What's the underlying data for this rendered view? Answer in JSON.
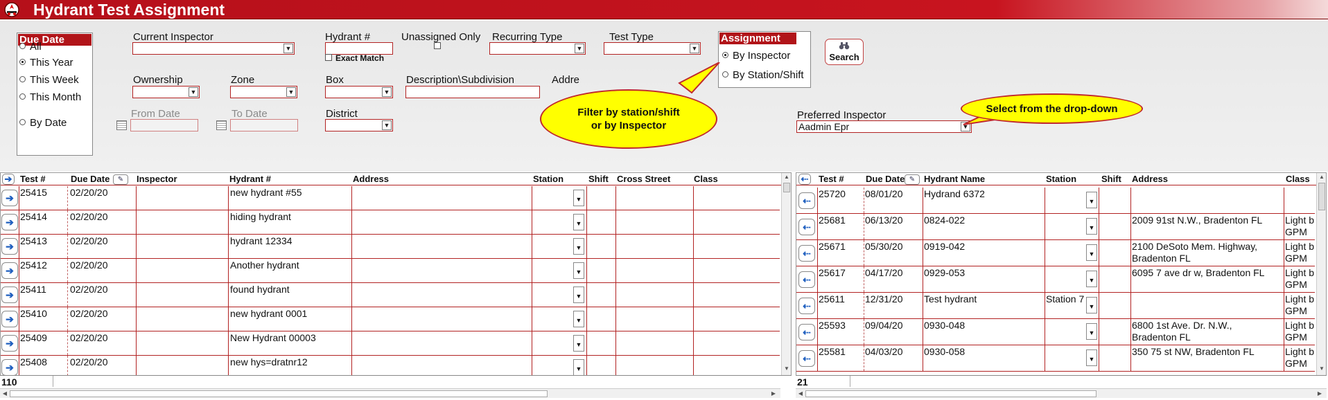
{
  "title": "Hydrant Test Assignment",
  "icons": {
    "logo": "fire-dept-logo-icon",
    "search": "binoculars-icon",
    "move_right": "arrow-right-icon",
    "move_left": "arrow-left-icon",
    "edit": "pencil-icon",
    "dropdown": "chevron-down-icon",
    "calendar": "calendar-icon"
  },
  "colors": {
    "accent": "#b11419",
    "callout": "#ffff00",
    "nav_arrow": "#1f5fbf"
  },
  "due_date": {
    "header": "Due Date",
    "options": [
      "All",
      "This Year",
      "This Week",
      "This Month",
      "By Date"
    ],
    "selected": "This Year"
  },
  "filters": {
    "current_inspector": {
      "label": "Current Inspector",
      "value": ""
    },
    "hydrant_number": {
      "label": "Hydrant #",
      "value": ""
    },
    "exact_match": {
      "label": "Exact Match",
      "checked": false
    },
    "unassigned_only": {
      "label": "Unassigned Only",
      "checked": false
    },
    "recurring_type": {
      "label": "Recurring Type",
      "value": ""
    },
    "test_type": {
      "label": "Test Type",
      "value": ""
    },
    "ownership": {
      "label": "Ownership",
      "value": ""
    },
    "zone": {
      "label": "Zone",
      "value": ""
    },
    "box": {
      "label": "Box",
      "value": ""
    },
    "description": {
      "label": "Description\\Subdivision",
      "value": ""
    },
    "address": {
      "label": "Addre"
    },
    "from_date": {
      "label": "From Date",
      "value": ""
    },
    "to_date": {
      "label": "To Date",
      "value": ""
    },
    "district": {
      "label": "District",
      "value": ""
    }
  },
  "assignment": {
    "header": "Assignment",
    "options": [
      "By Inspector",
      "By Station/Shift"
    ],
    "selected": "By Inspector"
  },
  "search_label": "Search",
  "preferred_inspector": {
    "label": "Preferred Inspector",
    "value": "Aadmin Epr"
  },
  "callouts": {
    "filter": "Filter by station/shift\nor by Inspector",
    "dropdown": "Select from the drop-down"
  },
  "left_grid": {
    "headers": [
      "Test #",
      "Due Date",
      "Inspector",
      "Hydrant #",
      "Address",
      "Station",
      "Shift",
      "Cross Street",
      "Class"
    ],
    "rows": [
      {
        "test": "25415",
        "due": "02/20/20",
        "inspector": "",
        "hydrant": "new hydrant #55",
        "address": ""
      },
      {
        "test": "25414",
        "due": "02/20/20",
        "inspector": "",
        "hydrant": "hiding hydrant",
        "address": ""
      },
      {
        "test": "25413",
        "due": "02/20/20",
        "inspector": "",
        "hydrant": "hydrant 12334",
        "address": ""
      },
      {
        "test": "25412",
        "due": "02/20/20",
        "inspector": "",
        "hydrant": "Another hydrant",
        "address": ""
      },
      {
        "test": "25411",
        "due": "02/20/20",
        "inspector": "",
        "hydrant": "found hydrant",
        "address": ""
      },
      {
        "test": "25410",
        "due": "02/20/20",
        "inspector": "",
        "hydrant": "new hydrant 0001",
        "address": ""
      },
      {
        "test": "25409",
        "due": "02/20/20",
        "inspector": "",
        "hydrant": "New Hydrant 00003",
        "address": ""
      },
      {
        "test": "25408",
        "due": "02/20/20",
        "inspector": "",
        "hydrant": "new hys=dratnr12",
        "address": ""
      }
    ],
    "count": "110"
  },
  "right_grid": {
    "headers": [
      "Test #",
      "Due Date",
      "Hydrant Name",
      "Station",
      "Shift",
      "Address",
      "Class"
    ],
    "rows": [
      {
        "test": "25720",
        "due": "08/01/20",
        "name": "Hydrand 6372",
        "station": "",
        "address": "",
        "class": ""
      },
      {
        "test": "25681",
        "due": "06/13/20",
        "name": "0824-022",
        "station": "",
        "address": "2009 91st  N.W., Bradenton FL",
        "class": "Light b\nGPM"
      },
      {
        "test": "25671",
        "due": "05/30/20",
        "name": "0919-042",
        "station": "",
        "address": "2100 DeSoto Mem. Highway,\nBradenton FL",
        "class": "Light b\nGPM"
      },
      {
        "test": "25617",
        "due": "04/17/20",
        "name": "0929-053",
        "station": "",
        "address": "6095 7 ave dr w, Bradenton FL",
        "class": "Light b\nGPM"
      },
      {
        "test": "25611",
        "due": "12/31/20",
        "name": "Test hydrant",
        "station": "Station 7",
        "address": "",
        "class": "Light b\nGPM"
      },
      {
        "test": "25593",
        "due": "09/04/20",
        "name": "0930-048",
        "station": "",
        "address": "6800 1st Ave. Dr. N.W.,\nBradenton FL",
        "class": "Light b\nGPM"
      },
      {
        "test": "25581",
        "due": "04/03/20",
        "name": "0930-058",
        "station": "",
        "address": "350 75 st NW, Bradenton FL",
        "class": "Light b\nGPM"
      }
    ],
    "count": "21"
  }
}
